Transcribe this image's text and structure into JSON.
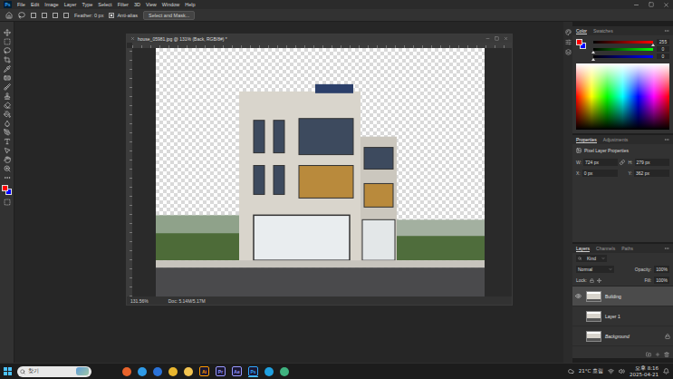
{
  "app": {
    "logo": "Ps"
  },
  "menu": [
    "File",
    "Edit",
    "Image",
    "Layer",
    "Type",
    "Select",
    "Filter",
    "3D",
    "View",
    "Window",
    "Help"
  ],
  "options": {
    "feather_label": "Feather:",
    "feather_value": "0 px",
    "antialias": {
      "label": "Anti-alias",
      "checked": true
    },
    "select_mask": "Select and Mask..."
  },
  "document": {
    "title": "house_05981.jpg @ 131% (Back, RGB/8#) *",
    "zoom": "131.56%",
    "doc_size": "Doc: 5.14M/5.17M"
  },
  "color_panel": {
    "tabs": [
      {
        "label": "Color",
        "selected": true
      },
      {
        "label": "Swatches",
        "selected": false
      }
    ],
    "foreground": "#ff0000",
    "background": "#0000ff",
    "sliders": [
      {
        "value": "255",
        "level": 1,
        "color": "#ff0000"
      },
      {
        "value": "0",
        "level": 0,
        "color": "#00ff00"
      },
      {
        "value": "0",
        "level": 0,
        "color": "#0000ff"
      }
    ]
  },
  "properties": {
    "tabs": [
      {
        "label": "Properties",
        "selected": true
      },
      {
        "label": "Adjustments",
        "selected": false
      }
    ],
    "heading": "Pixel Layer Properties",
    "linked": true,
    "fields": [
      {
        "label": "W:",
        "value": "724 px"
      },
      {
        "label": "H:",
        "value": "279 px"
      },
      {
        "label": "X:",
        "value": "0 px"
      },
      {
        "label": "Y:",
        "value": "362 px"
      }
    ]
  },
  "layers": {
    "tabs": [
      {
        "label": "Layers",
        "selected": true
      },
      {
        "label": "Channels",
        "selected": false
      },
      {
        "label": "Paths",
        "selected": false
      }
    ],
    "filter": "Kind",
    "blend_mode": "Normal",
    "opacity_label": "Opacity:",
    "opacity": "100%",
    "lock_label": "Lock:",
    "fill_label": "Fill:",
    "fill": "100%",
    "items": [
      {
        "name": "Building",
        "visible": true,
        "selected": true,
        "locked": false
      },
      {
        "name": "Layer 1",
        "visible": false,
        "selected": false,
        "locked": false
      },
      {
        "name": "Background",
        "visible": false,
        "selected": false,
        "locked": true
      }
    ]
  },
  "taskbar": {
    "search": "찾기",
    "apps": [
      {
        "kind": "glyph",
        "label": "",
        "color": "#e8632b",
        "active": false
      },
      {
        "kind": "glyph",
        "label": "",
        "color": "#2f9be8",
        "active": false
      },
      {
        "kind": "glyph",
        "label": "",
        "color": "#2a72d8",
        "active": false
      },
      {
        "kind": "glyph",
        "label": "",
        "color": "#e9b62f",
        "active": false
      },
      {
        "kind": "glyph",
        "label": "",
        "color": "#f3c450",
        "active": false
      },
      {
        "kind": "badge",
        "label": "Ai",
        "color": "#ff9a00",
        "active": false
      },
      {
        "kind": "badge",
        "label": "Pr",
        "color": "#9999ff",
        "active": false
      },
      {
        "kind": "badge",
        "label": "Ae",
        "color": "#9999ff",
        "active": false
      },
      {
        "kind": "badge",
        "label": "Ps",
        "color": "#31a8ff",
        "active": true
      },
      {
        "kind": "glyph",
        "label": "",
        "color": "#1fa0e0",
        "active": false
      },
      {
        "kind": "glyph",
        "label": "",
        "color": "#3fb27f",
        "active": false
      }
    ],
    "weather": "21°C 흐림",
    "time": "오후 8:16",
    "date": "2025-04-21"
  }
}
